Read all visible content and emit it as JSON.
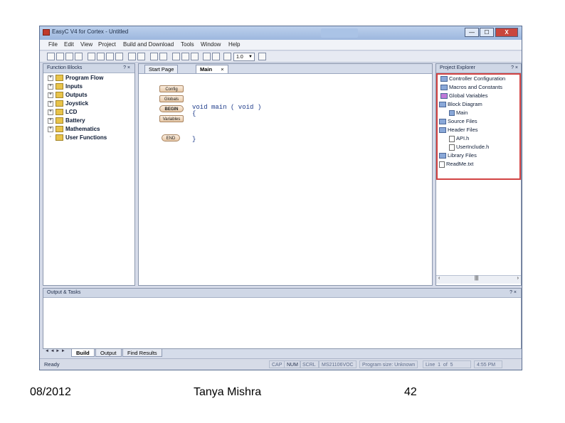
{
  "window": {
    "title": "EasyC V4 for Cortex - Untitled",
    "controls": {
      "minimize": "—",
      "maximize": "☐",
      "close": "X"
    }
  },
  "menu": [
    "File",
    "Edit",
    "View",
    "Project",
    "Build and Download",
    "Tools",
    "Window",
    "Help"
  ],
  "toolbar": {
    "zoom": "1.0"
  },
  "function_blocks": {
    "title": "Function Blocks",
    "pin": "? ×",
    "items": [
      "Program Flow",
      "Inputs",
      "Outputs",
      "Joystick",
      "LCD",
      "Battery",
      "Mathematics",
      "User Functions"
    ]
  },
  "editor": {
    "tabs": [
      "Start Page",
      "Main"
    ],
    "tab_close": "×",
    "blocks": [
      "Config",
      "Globals",
      "BEGIN",
      "Variables",
      "END"
    ],
    "code": [
      "void main ( void )",
      "{",
      "}"
    ]
  },
  "project_explorer": {
    "title": "Project Explorer",
    "pin": "? ×",
    "items": [
      "Controller Configuration",
      "Macros and Constants",
      "Global Variables",
      "Block Diagram",
      "Main",
      "Source Files",
      "Header Files",
      "API.h",
      "UserInclude.h",
      "Library Files",
      "ReadMe.txt"
    ]
  },
  "output": {
    "title": "Output & Tasks",
    "pin": "? ×"
  },
  "bottom_tabs": [
    "Build",
    "Output",
    "Find Results"
  ],
  "status": {
    "ready": "Ready",
    "cap": "CAP",
    "num": "NUM",
    "scrl": "SCRL",
    "mcu": "MS21106VOC",
    "program_size": "Program size: Unknown",
    "line": "Line",
    "line_num": "1",
    "of": "of",
    "line_total": "5",
    "time": "4:55 PM"
  },
  "footer": {
    "date": "08/2012",
    "author": "Tanya Mishra",
    "page": "42"
  }
}
